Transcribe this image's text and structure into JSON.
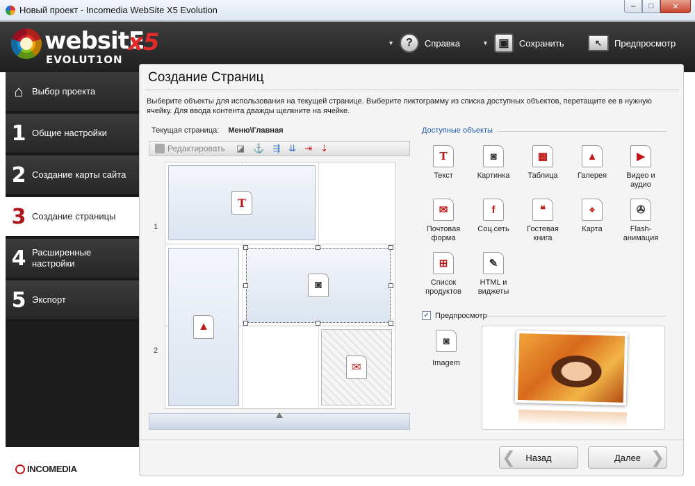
{
  "window": {
    "title": "Новый проект - Incomedia WebSite X5 Evolution",
    "min": "–",
    "max": "□",
    "close": "✕"
  },
  "logo": {
    "word": "websitE",
    "x5": "x5",
    "sub": "EVOLUT1ON"
  },
  "header": {
    "help_label": "Справка",
    "save_label": "Сохранить",
    "preview_label": "Предпросмотр"
  },
  "nav": [
    {
      "num": "",
      "label": "Выбор проекта"
    },
    {
      "num": "1",
      "label": "Общие настройки"
    },
    {
      "num": "2",
      "label": "Создание карты сайта"
    },
    {
      "num": "3",
      "label": "Создание страницы"
    },
    {
      "num": "4",
      "label": "Расширенные настройки"
    },
    {
      "num": "5",
      "label": "Экспорт"
    }
  ],
  "brand": "INCOMEDIA",
  "main": {
    "title": "Создание Страниц",
    "description": "Выберите объекты для использования на текущей странице. Выберите пиктограмму из списка доступных объектов, перетащите ее в нужную ячейку. Для ввода контента дважды щелкните на ячейке.",
    "current_page_label": "Текущая страница:",
    "current_page_value": "Меню\\Главная",
    "edit_label": "Редактировать",
    "row1": "1",
    "row2": "2"
  },
  "available": {
    "title": "Доступные объекты",
    "items": [
      {
        "label": "Текст",
        "icon": "T"
      },
      {
        "label": "Картинка",
        "icon": "◙"
      },
      {
        "label": "Таблица",
        "icon": "▦"
      },
      {
        "label": "Галерея",
        "icon": "▲"
      },
      {
        "label": "Видео и аудио",
        "icon": "▶"
      },
      {
        "label": "Почтовая форма",
        "icon": "✉"
      },
      {
        "label": "Соц.сеть",
        "icon": "f"
      },
      {
        "label": "Гостевая книга",
        "icon": "❝"
      },
      {
        "label": "Карта",
        "icon": "⌖"
      },
      {
        "label": "Flash-анимация",
        "icon": "✇"
      },
      {
        "label": "Список продуктов",
        "icon": "⊞"
      },
      {
        "label": "HTML и виджеты",
        "icon": "✎"
      }
    ]
  },
  "preview": {
    "checkbox_label": "Предпросмотр",
    "checked": "✓",
    "object_label": "Imagem"
  },
  "buttons": {
    "back": "Назад",
    "next": "Далее"
  }
}
